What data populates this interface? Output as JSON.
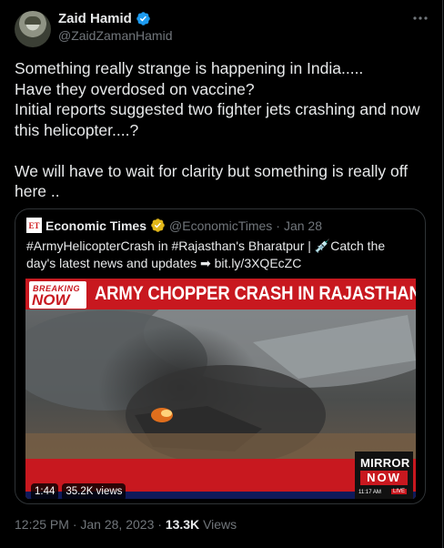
{
  "author": {
    "name": "Zaid Hamid",
    "handle": "@ZaidZamanHamid"
  },
  "icons": {
    "verified": "verified-badge-icon",
    "more": "more-options-icon",
    "avatar": "profile-avatar"
  },
  "tweet": {
    "lines": [
      "Something really strange is happening in India.....",
      "Have they overdosed on vaccine?",
      "Initial reports suggested two fighter jets crashing and now this helicopter....?",
      "",
      "We will have to wait for clarity but something is really off here .."
    ]
  },
  "quote": {
    "logo_text": "ET",
    "name": "Economic Times",
    "handle": "@EconomicTimes",
    "separator": "·",
    "date": "Jan 28",
    "text": "#ArmyHelicopterCrash in #Rajasthan's Bharatpur | 💉Catch the day's latest news and updates ➡ bit.ly/3XQEcZC",
    "video": {
      "breaking_top": "BREAKING",
      "breaking_bottom": "NOW",
      "headline": "ARMY CHOPPER CRASH IN RAJASTHAN",
      "channel_top": "MIRROR",
      "channel_bottom": "NOW",
      "channel_time": "11:17 AM",
      "channel_live": "LIVE",
      "duration": "1:44",
      "views": "35.2K views"
    }
  },
  "meta": {
    "time": "12:25 PM",
    "separator": "·",
    "date": "Jan 28, 2023",
    "views_count": "13.3K",
    "views_label": "Views"
  },
  "colors": {
    "background": "#000000",
    "text": "#e7e9ea",
    "secondary": "#71767b",
    "border": "#2f3336",
    "verified": "#1d9bf0",
    "news_red": "#c8181f"
  }
}
